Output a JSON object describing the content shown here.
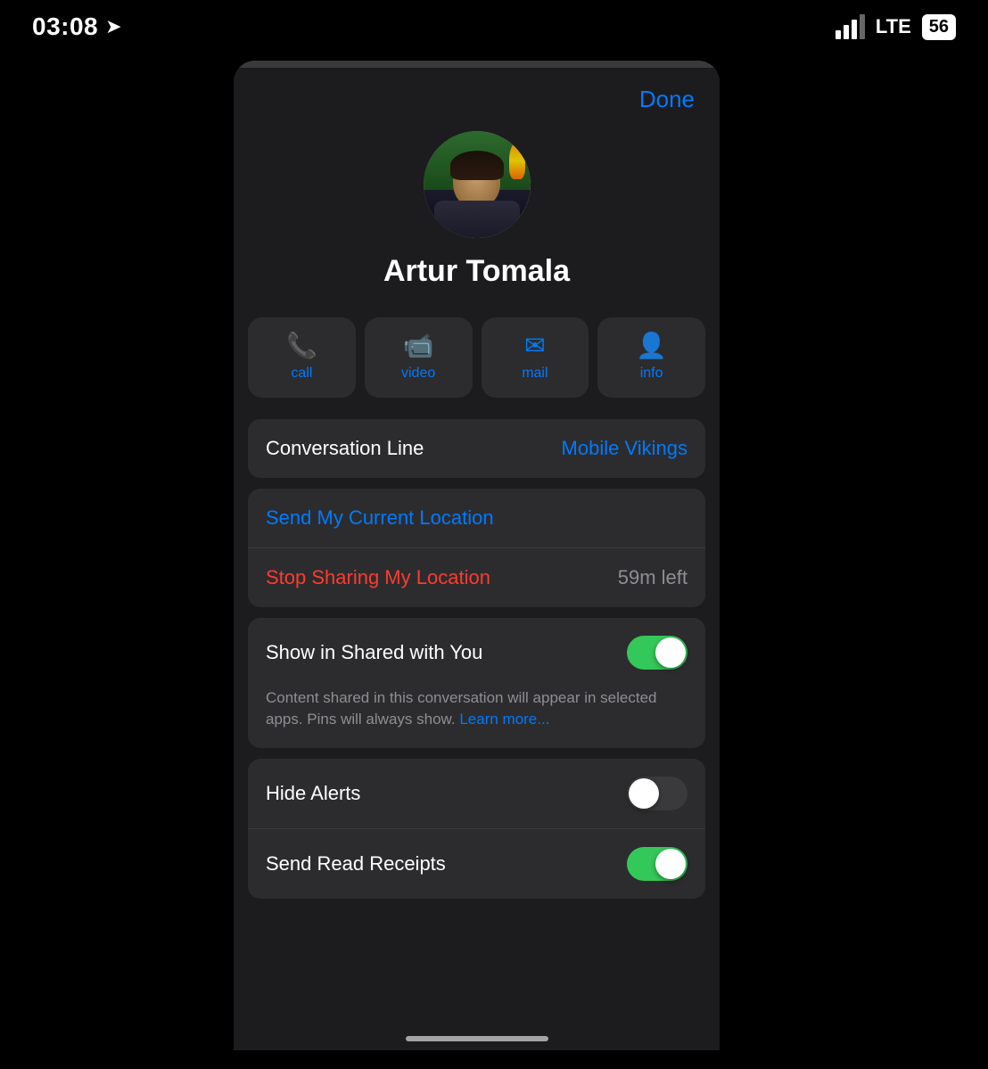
{
  "statusBar": {
    "time": "03:08",
    "networkType": "LTE",
    "batteryLevel": "56",
    "navigationArrow": "➤"
  },
  "header": {
    "doneLabel": "Done"
  },
  "contact": {
    "name": "Artur Tomala"
  },
  "actionButtons": [
    {
      "id": "call",
      "icon": "📞",
      "label": "call"
    },
    {
      "id": "video",
      "icon": "📹",
      "label": "video"
    },
    {
      "id": "mail",
      "icon": "✉",
      "label": "mail"
    },
    {
      "id": "info",
      "icon": "👤",
      "label": "info"
    }
  ],
  "conversationLine": {
    "label": "Conversation Line",
    "value": "Mobile Vikings"
  },
  "locationSection": {
    "sendLabel": "Send My Current Location",
    "stopLabel": "Stop Sharing My Location",
    "timeLeft": "59m left"
  },
  "sharedSection": {
    "label": "Show in Shared with You",
    "toggleState": "on",
    "description": "Content shared in this conversation will appear in selected apps. Pins will always show.",
    "learnMoreLabel": "Learn more..."
  },
  "alertsSection": {
    "hideAlertsLabel": "Hide Alerts",
    "hideAlertsToggle": "off",
    "sendReadReceiptsLabel": "Send Read Receipts",
    "sendReadReceiptsToggle": "on"
  }
}
